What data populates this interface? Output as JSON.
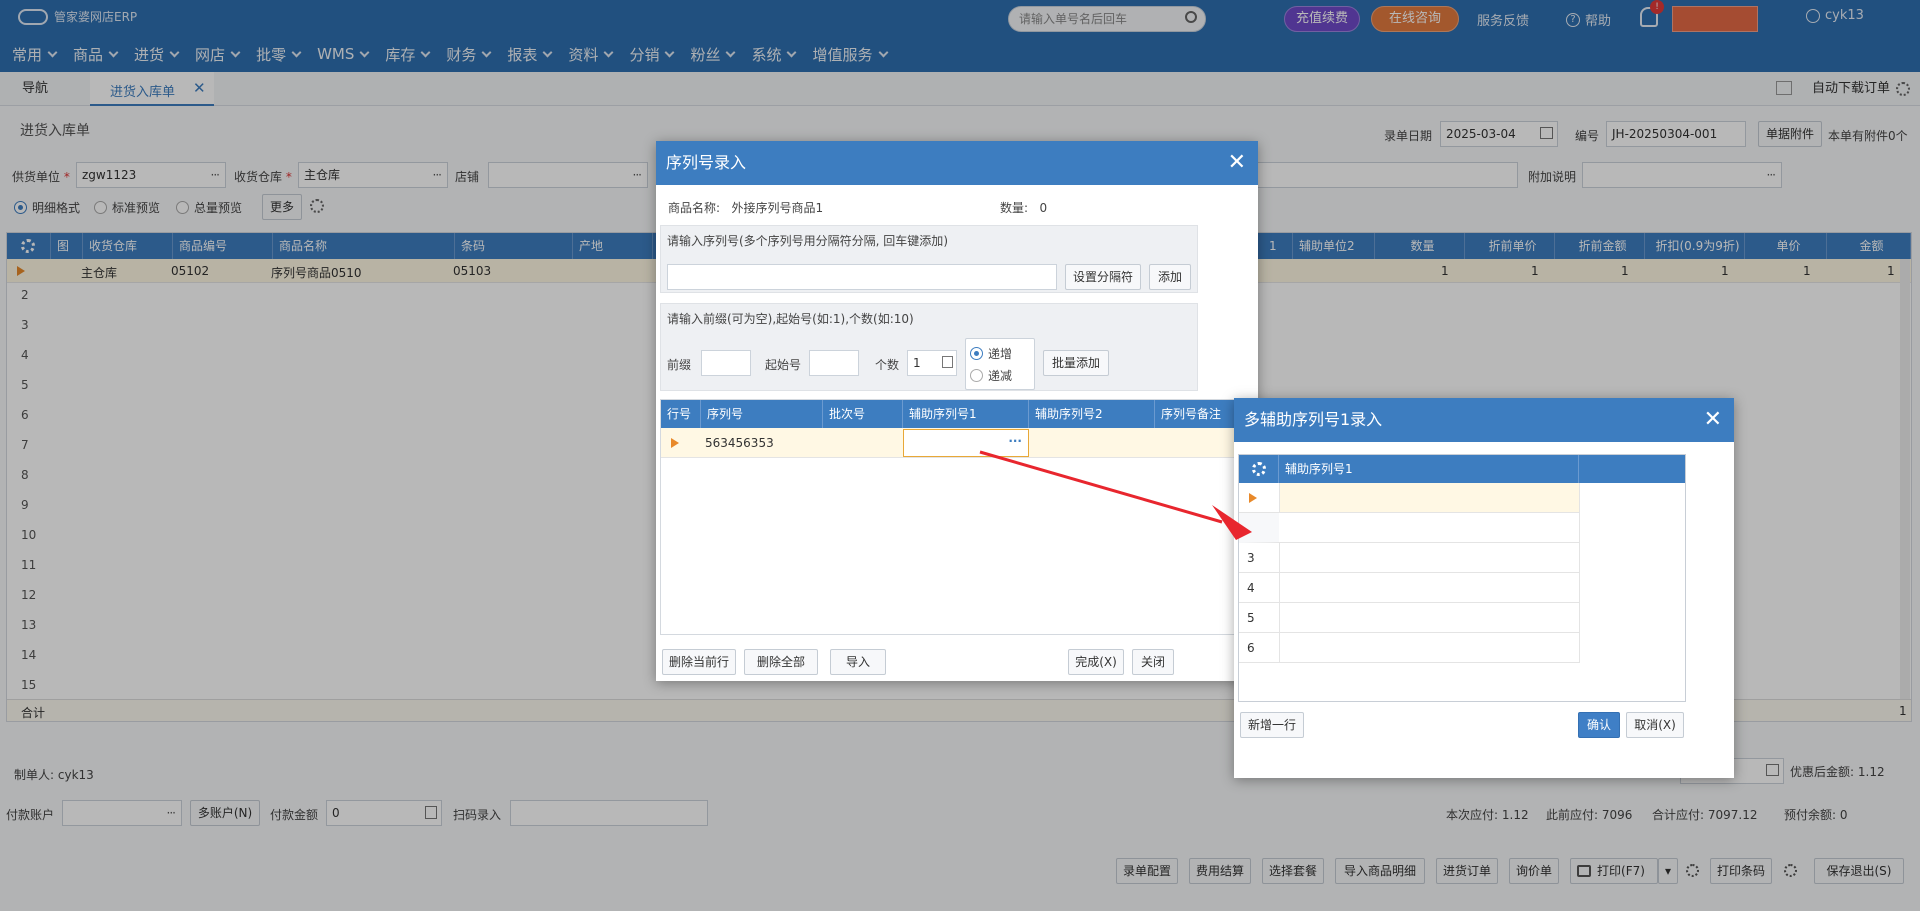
{
  "header": {
    "logo": "管家婆网店ERP",
    "search_placeholder": "请输入单号名后回车",
    "recharge": "充值续费",
    "online_consult": "在线咨询",
    "feedback": "服务反馈",
    "help": "帮助",
    "bell_badge": "!",
    "username": "cyk13"
  },
  "menu": [
    "常用",
    "商品",
    "进货",
    "网店",
    "批零",
    "WMS",
    "库存",
    "财务",
    "报表",
    "资料",
    "分销",
    "粉丝",
    "系统",
    "增值服务"
  ],
  "tabs": {
    "nav": "导航",
    "active": "进货入库单",
    "auto_download": "自动下载订单"
  },
  "page": {
    "title": "进货入库单",
    "date_label": "录单日期",
    "date_value": "2025-03-04",
    "no_label": "编号",
    "no_value": "JH-20250304-001",
    "attach_btn": "单据附件",
    "attach_info": "本单有附件0个",
    "supplier_label": "供货单位",
    "supplier_value": "zgw1123",
    "warehouse_label": "收货仓库",
    "warehouse_value": "主仓库",
    "store_label": "店铺",
    "extra_label": "附加说明",
    "radio1": "明细格式",
    "radio2": "标准预览",
    "radio3": "总量预览",
    "more_btn": "更多",
    "columns": [
      "图",
      "收货仓库",
      "商品编号",
      "商品名称",
      "条码",
      "产地"
    ],
    "columns_right": [
      "1",
      "辅助单位2",
      "数量",
      "折前单价",
      "折前金额",
      "折扣(0.9为9折)",
      "单价",
      "金额"
    ],
    "row1": {
      "warehouse": "主仓库",
      "code": "05102",
      "name": "序列号商品0510",
      "barcode": "05103",
      "qty": "1",
      "unit_price": "1",
      "amount": "1",
      "discount": "1",
      "price": "1",
      "total": "1"
    },
    "row_numbers": [
      "2",
      "3",
      "4",
      "5",
      "6",
      "7",
      "8",
      "9",
      "10",
      "11",
      "12",
      "13",
      "14",
      "15"
    ],
    "total_label": "合计",
    "total_value": "1",
    "maker_label": "制单人:",
    "maker_value": "cyk13",
    "discount_after_label": "优惠后金额:",
    "discount_after_value": "1.12",
    "pay_account_label": "付款账户",
    "multi_account_btn": "多账户(N)",
    "pay_amount_label": "付款金额",
    "pay_amount_value": "0",
    "scan_label": "扫码录入",
    "this_pay_label": "本次应付:",
    "this_pay_value": "1.12",
    "prev_pay_label": "此前应付:",
    "prev_pay_value": "7096",
    "sum_pay_label": "合计应付:",
    "sum_pay_value": "7097.12",
    "prepaid_label": "预付余额:",
    "prepaid_value": "0",
    "bottom_buttons": [
      "录单配置",
      "费用结算",
      "选择套餐",
      "导入商品明细",
      "进货订单",
      "询价单"
    ],
    "print_btn": "打印(F7)",
    "print_barcode_btn": "打印条码",
    "save_exit_btn": "保存退出(S)"
  },
  "serial_dialog": {
    "title": "序列号录入",
    "product_label": "商品名称:",
    "product_value": "外接序列号商品1",
    "qty_label": "数量:",
    "qty_value": "0",
    "hint1": "请输入序列号(多个序列号用分隔符分隔, 回车键添加)",
    "set_sep_btn": "设置分隔符",
    "add_btn": "添加",
    "hint2": "请输入前缀(可为空),起始号(如:1),个数(如:10)",
    "prefix_label": "前缀",
    "start_label": "起始号",
    "count_label": "个数",
    "count_value": "1",
    "inc_label": "递增",
    "dec_label": "递减",
    "batch_add_btn": "批量添加",
    "columns": [
      "行号",
      "序列号",
      "批次号",
      "辅助序列号1",
      "辅助序列号2",
      "序列号备注"
    ],
    "row_serial": "563456353",
    "delete_row_btn": "删除当前行",
    "delete_all_btn": "删除全部",
    "import_btn": "导入",
    "finish_btn": "完成(X)",
    "close_btn": "关闭"
  },
  "aux_dialog": {
    "title": "多辅助序列号1录入",
    "column": "辅助序列号1",
    "row_numbers": [
      "3",
      "4",
      "5",
      "6"
    ],
    "add_row_btn": "新增一行",
    "confirm_btn": "确认",
    "cancel_btn": "取消(X)"
  },
  "colors": {
    "header_blue": "#2f6fb0",
    "grid_blue": "#3d7dc0",
    "arrow_red": "#e8262e",
    "highlight_row": "#fff8e4"
  }
}
